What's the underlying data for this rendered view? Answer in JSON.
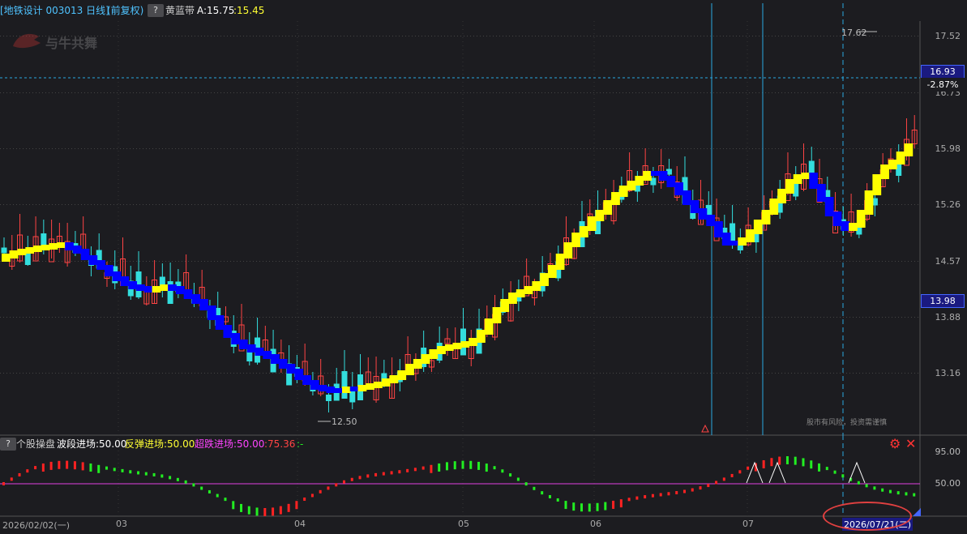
{
  "header": {
    "stock_title": "[地铁设计 003013 日线]",
    "adjust": "(前复权)",
    "help_icon": "?",
    "indicator_name": "黄蓝带",
    "indicator_a": "A:15.75",
    "indicator_b": ":15.45"
  },
  "watermark": "与牛共舞",
  "price_axis": {
    "ticks": [
      "17.52",
      "16.73",
      "15.98",
      "15.26",
      "14.57",
      "13.88",
      "13.16"
    ],
    "current_price": "16.93",
    "change_pct": "-2.87%",
    "cursor_price": "13.98"
  },
  "annotations": {
    "high_label": "17.62",
    "low_label": "12.50",
    "risk_notice": "股市有风险，投资需谨慎"
  },
  "indicator_panel": {
    "help_icon": "?",
    "name": "个股操盘",
    "wave": "波段进场:50.00",
    "rebound": "反弹进场:50.00",
    "oversold": "超跌进场:50.00",
    "value": ":75.36",
    "dash": ":-",
    "axis_top": "95.00",
    "axis_mid": "50.00"
  },
  "x_axis": {
    "start": "2026/02/02(一)",
    "m03": "03",
    "m04": "04",
    "m05": "05",
    "m06": "06",
    "m07": "07",
    "cursor_date": "2026/07/21(二)"
  },
  "colors": {
    "up": "#ff4444",
    "down": "#33dddd",
    "yellow_band": "#ffff00",
    "blue_band": "#0000ff",
    "osc_up": "#ff2222",
    "osc_down": "#22ee22",
    "magenta": "#e040e0"
  }
}
